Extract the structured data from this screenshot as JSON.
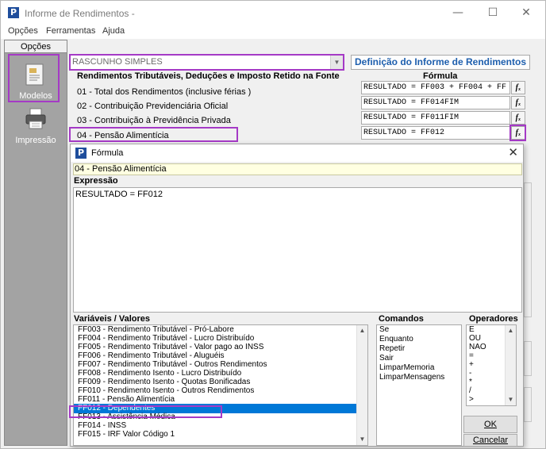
{
  "window": {
    "title": "Informe de Rendimentos -",
    "icon_letter": "P",
    "minimize": "—",
    "maximize": "☐",
    "close": "✕"
  },
  "menu": {
    "items": [
      "Opções",
      "Ferramentas",
      "Ajuda"
    ]
  },
  "sidebar": {
    "header": "Opções",
    "items": [
      {
        "label": "Modelos",
        "icon": "document-icon"
      },
      {
        "label": "Impressão",
        "icon": "printer-icon"
      }
    ]
  },
  "main": {
    "model_select": {
      "value": "RASCUNHO SIMPLES"
    },
    "definition_button": "Definição do Informe de Rendimentos",
    "section_title": "Rendimentos Tributáveis, Deduções e Imposto Retido na Fonte",
    "formula_header": "Fórmula",
    "rows": [
      {
        "label": "01 - Total dos Rendimentos (inclusive férias )",
        "formula": "RESULTADO = FF003 + FF004 + FF"
      },
      {
        "label": "02 - Contribuição Previdenciária Oficial",
        "formula": "RESULTADO = FF014FIM"
      },
      {
        "label": "03 - Contribuição à Previdência Privada",
        "formula": "RESULTADO = FF011FIM"
      },
      {
        "label": "04 - Pensão Alimentícia",
        "formula": "RESULTADO = FF012"
      }
    ],
    "fx_label": "fₓ"
  },
  "dialog": {
    "title": "Fórmula",
    "icon_letter": "P",
    "close": "✕",
    "selected_item": "04 - Pensão Alimentícia",
    "expression_header": "Expressão",
    "expression_value": "RESULTADO = FF012",
    "variables_header": "Variáveis / Valores",
    "variables": [
      "FF003 - Rendimento Tributável - Pró-Labore",
      "FF004 - Rendimento Tributável - Lucro Distribuído",
      "FF005 - Rendimento Tributável - Valor pago ao INSS",
      "FF006 - Rendimento Tributável - Aluguéis",
      "FF007 - Rendimento Tributável - Outros Rendimentos",
      "FF008 - Rendimento Isento - Lucro Distribuído",
      "FF009 - Rendimento Isento - Quotas Bonificadas",
      "FF010 - Rendimento Isento - Outros Rendimentos",
      "FF011 - Pensão Alimentícia",
      "FF012 - Dependentes",
      "FF013 - Assistência Médica",
      "FF014 - INSS",
      "FF015 - IRF Valor Código 1"
    ],
    "selected_variable": "FF012 - Dependentes",
    "commands_header": "Comandos",
    "commands": [
      "Se",
      "Enquanto",
      "Repetir",
      "Sair",
      "LimparMemoria",
      "LimparMensagens"
    ],
    "operators_header": "Operadores",
    "operators": [
      "E",
      "OU",
      "NAO",
      "=",
      "+",
      "-",
      "*",
      "/",
      ">"
    ],
    "ok_button": "OK",
    "cancel_button": "Cancelar"
  },
  "colors": {
    "highlight": "#a53ac6",
    "selection": "#0078d7",
    "link_blue": "#1e5fae",
    "info_bg": "#ffffe1"
  }
}
